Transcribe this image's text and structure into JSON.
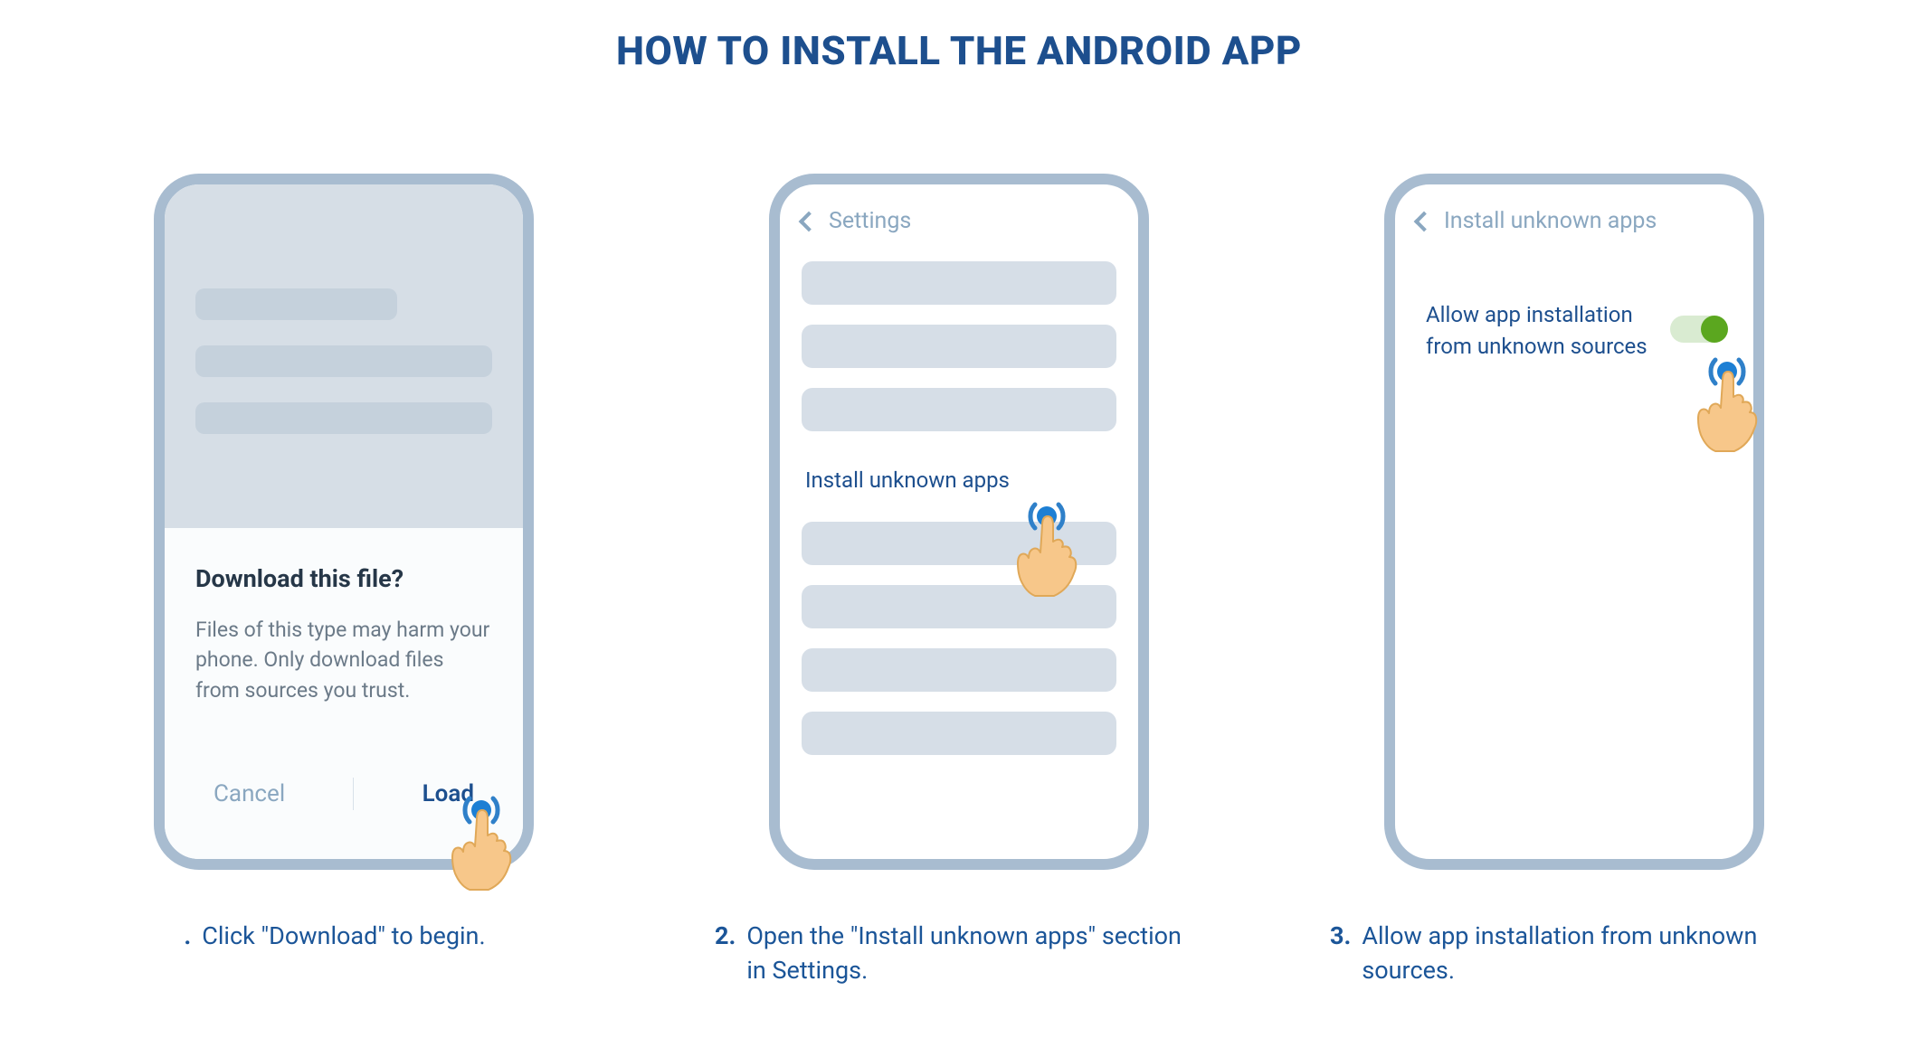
{
  "title": "HOW TO INSTALL THE ANDROID APP",
  "steps": [
    {
      "number": ".",
      "caption": "Click \"Download\" to begin.",
      "dialog": {
        "title": "Download this file?",
        "body": "Files of this type may harm your phone. Only download files from sources you trust.",
        "cancel": "Cancel",
        "confirm": "Load"
      }
    },
    {
      "number": "2.",
      "caption": "Open the \"Install unknown apps\" section in Settings.",
      "header": "Settings",
      "link": "Install unknown apps"
    },
    {
      "number": "3.",
      "caption": "Allow app installation from unknown sources.",
      "header": "Install unknown apps",
      "allow_label": "Allow app installation from unknown sources"
    }
  ]
}
